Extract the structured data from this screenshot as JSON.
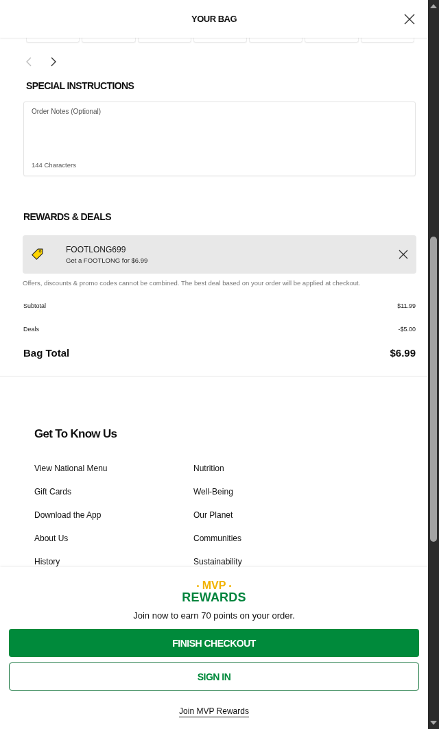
{
  "header": {
    "title": "YOUR BAG"
  },
  "carousel": {
    "arrows": [
      {
        "kind": "prev",
        "disabled": true
      },
      {
        "kind": "next",
        "disabled": false
      }
    ]
  },
  "special_instructions": {
    "heading": "SPECIAL INSTRUCTIONS",
    "notes_field": {
      "placeholder": "Order Notes (Optional)",
      "counter": "144 Characters"
    }
  },
  "rewards_deals": {
    "heading": "REWARDS & DEALS",
    "applied_deals": [
      {
        "code": "FOOTLONG699",
        "description": "Get a FOOTLONG for $6.99"
      }
    ],
    "disclaimer": "Offers, discounts & promo codes cannot be combined. The best deal based on your order will be applied at checkout."
  },
  "summary": {
    "lines": [
      {
        "kind": "line",
        "label": "Subtotal",
        "value": "$11.99"
      },
      {
        "kind": "line",
        "label": "Deals",
        "value": "-$5.00"
      },
      {
        "kind": "total",
        "label": "Bag Total",
        "value": "$6.99"
      }
    ]
  },
  "footer": {
    "heading": "Get To Know Us",
    "columns": [
      {
        "links": [
          "View National Menu",
          "Gift Cards",
          "Download the App",
          "About Us",
          "History"
        ]
      },
      {
        "links": [
          "Nutrition",
          "Well-Being",
          "Our Planet",
          "Communities",
          "Sustainability"
        ]
      }
    ]
  },
  "checkout_panel": {
    "logo": {
      "top": "MVP",
      "bottom": "REWARDS"
    },
    "message": "Join now to earn 70 points on your order.",
    "buttons": [
      {
        "kind": "primary",
        "label": "FINISH CHECKOUT"
      },
      {
        "kind": "secondary",
        "label": "SIGN IN"
      }
    ],
    "link": "Join MVP Rewards"
  }
}
